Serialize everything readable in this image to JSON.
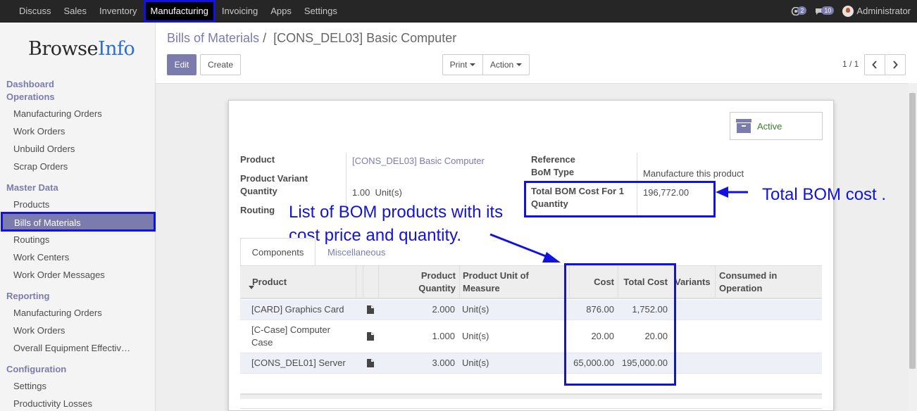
{
  "topbar": {
    "menu": [
      "Discuss",
      "Sales",
      "Inventory",
      "Manufacturing",
      "Invoicing",
      "Apps",
      "Settings"
    ],
    "active_menu": "Manufacturing",
    "chat_count": "2",
    "activity_count": "10",
    "user": "Administrator"
  },
  "sidebar": {
    "logo_a": "Browse",
    "logo_b": "Info",
    "dashboard": "Dashboard",
    "operations": "Operations",
    "operations_items": [
      "Manufacturing Orders",
      "Work Orders",
      "Unbuild Orders",
      "Scrap Orders"
    ],
    "master_data": "Master Data",
    "master_items": [
      "Products",
      "Bills of Materials",
      "Routings",
      "Work Centers",
      "Work Order Messages"
    ],
    "reporting": "Reporting",
    "reporting_items": [
      "Manufacturing Orders",
      "Work Orders",
      "Overall Equipment Effectiv…"
    ],
    "configuration": "Configuration",
    "config_items": [
      "Settings",
      "Productivity Losses"
    ]
  },
  "breadcrumb": {
    "parent": "Bills of Materials",
    "sep": "/",
    "current": "[CONS_DEL03] Basic Computer"
  },
  "buttons": {
    "edit": "Edit",
    "create": "Create",
    "print": "Print",
    "action": "Action"
  },
  "pager": "1 / 1",
  "form": {
    "active_label": "Active",
    "product_label": "Product",
    "product_value": "[CONS_DEL03] Basic Computer",
    "variant_label": "Product Variant",
    "quantity_label": "Quantity",
    "quantity_value": "1.00",
    "quantity_uom": "Unit(s)",
    "routing_label": "Routing",
    "reference_label": "Reference",
    "bom_type_label": "BoM Type",
    "bom_type_value": "Manufacture this product",
    "total_cost_label_1": "Total BOM Cost For 1",
    "total_cost_label_2": "Quantity",
    "total_cost_value": "196,772.00"
  },
  "annotations": {
    "total": "Total BOM cost .",
    "list_1": "List of BOM products with its",
    "list_2": "cost price and quantity."
  },
  "tabs": [
    "Components",
    "Miscellaneous"
  ],
  "table": {
    "headers": {
      "product": "Product",
      "qty_1": "Product",
      "qty_2": "Quantity",
      "uom_1": "Product Unit of",
      "uom_2": "Measure",
      "cost": "Cost",
      "total_cost": "Total Cost",
      "variants": "Variants",
      "consumed_1": "Consumed in",
      "consumed_2": "Operation"
    },
    "rows": [
      {
        "product": "[CARD] Graphics Card",
        "qty": "2.000",
        "uom": "Unit(s)",
        "cost": "876.00",
        "total": "1,752.00"
      },
      {
        "product_1": "[C-Case] Computer",
        "product_2": "Case",
        "qty": "1.000",
        "uom": "Unit(s)",
        "cost": "20.00",
        "total": "20.00"
      },
      {
        "product": "[CONS_DEL01] Server",
        "qty": "3.000",
        "uom": "Unit(s)",
        "cost": "65,000.00",
        "total": "195,000.00"
      }
    ]
  }
}
